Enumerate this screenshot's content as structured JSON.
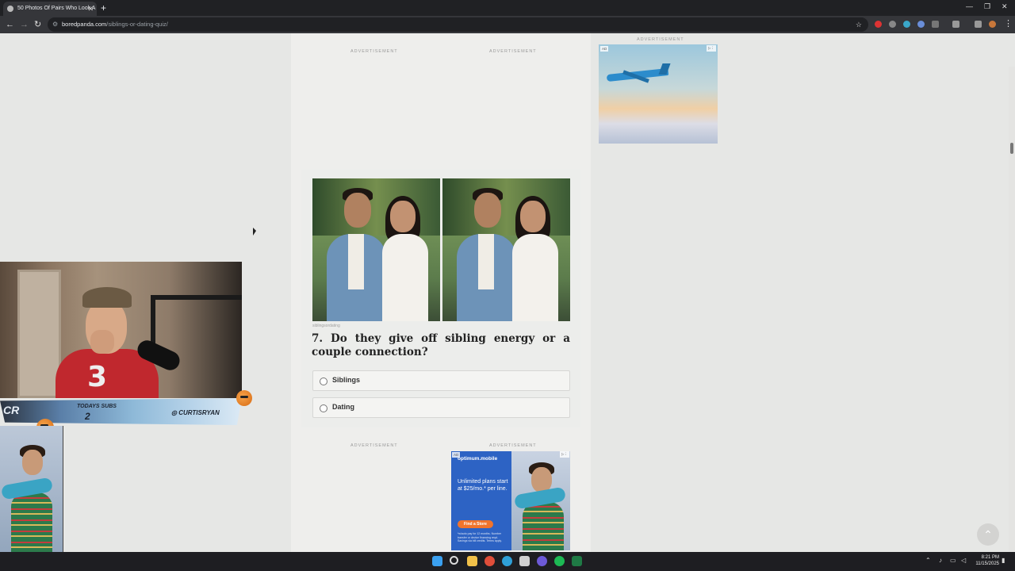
{
  "browser": {
    "tab_title": "50 Photos Of Pairs Who Look A",
    "url_host": "boredpanda.com",
    "url_path": "/siblings-or-dating-quiz/"
  },
  "ads": {
    "label": "ADVERTISEMENT",
    "badge": "AD",
    "phone_ad": {
      "brand": "optimum.mobile",
      "headline": "Unlimited plans start at $25/mo.* per line.",
      "cta": "Find a Store",
      "fine_print": "*w/auto pay for 12 months. Number transfer or device financing reqd. Savings via bill credits. Terms apply."
    }
  },
  "quiz": {
    "photo_credit": "siblingsordating",
    "question": "7. Do they give off sibling energy or a couple connection?",
    "options": [
      "Siblings",
      "Dating"
    ]
  },
  "stream": {
    "todays_subs_label": "TODAYS SUBS",
    "todays_subs_count": "2",
    "social_handle": "CURTISRYAN",
    "logo": "CR",
    "jersey_number": "3"
  },
  "taskbar": {
    "time": "8:21 PM",
    "date": "11/15/2025"
  },
  "colors": {
    "quiz_text": "#222222",
    "phone_ad_blue": "#2d63c4",
    "cta_orange": "#f0742c",
    "jersey_red": "#c0282e"
  }
}
